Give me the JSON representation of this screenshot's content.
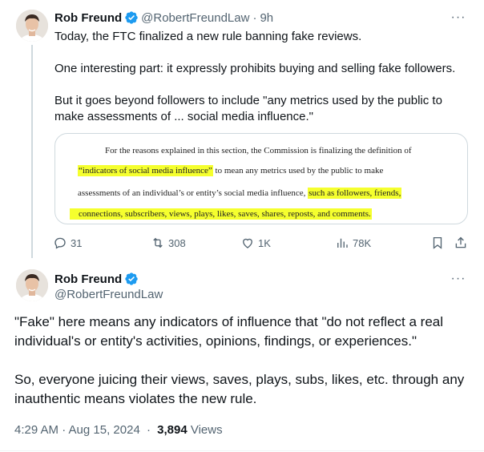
{
  "colors": {
    "text": "#0f1419",
    "muted": "#536471",
    "verified_blue": "#1d9bf0",
    "highlight": "#f5ff2e",
    "border": "#cfd9de"
  },
  "tweet1": {
    "author_name": "Rob Freund",
    "handle": "@RobertFreundLaw",
    "separator": "·",
    "time": "9h",
    "more_label": "···",
    "paragraphs": [
      "Today, the FTC finalized a new rule banning fake reviews.",
      "One interesting part: it expressly prohibits buying and selling fake followers.",
      "But it goes beyond followers to include \"any metrics used by the public to make assessments of ... social media influence.\""
    ],
    "media": {
      "line1": "For the reasons explained in this section, the Commission is finalizing the definition of",
      "line2_hl": "“indicators of social media influence”",
      "line2_rest": " to mean any metrics used by the public to make",
      "line3_plain": "assessments of an individual’s or entity’s social media influence, ",
      "line3_hl": "such as followers, friends,",
      "line4_hl": "connections, subscribers, views, plays, likes, saves, shares, reposts, and comments."
    },
    "actions": {
      "replies": "31",
      "reposts": "308",
      "likes": "1K",
      "views": "78K"
    }
  },
  "tweet2": {
    "author_name": "Rob Freund",
    "handle": "@RobertFreundLaw",
    "more_label": "···",
    "paragraphs": [
      "\"Fake\" here means any indicators of influence that \"do not reflect a real individual's or entity's activities, opinions, findings, or experiences.\"",
      "So, everyone juicing their views, saves, plays, subs, likes, etc. through any inauthentic means violates the new rule."
    ],
    "timestamp": "4:29 AM · Aug 15, 2024",
    "dot": "·",
    "views_count": "3,894",
    "views_label": "Views"
  }
}
